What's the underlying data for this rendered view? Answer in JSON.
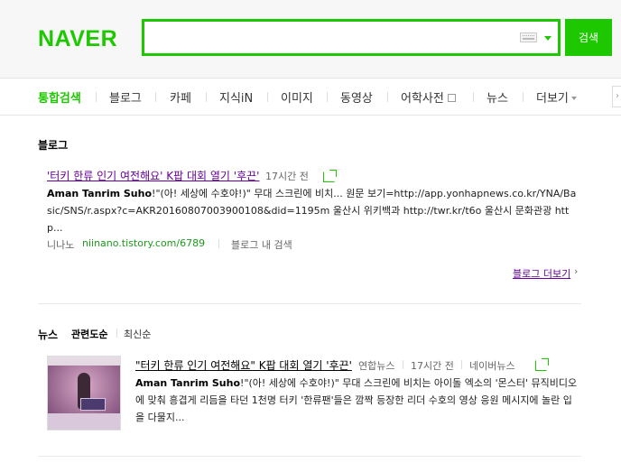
{
  "header": {
    "logo": "NAVER",
    "search_value": "",
    "search_button": "검색"
  },
  "tabs": [
    {
      "label": "통합검색",
      "active": true
    },
    {
      "label": "블로그"
    },
    {
      "label": "카페"
    },
    {
      "label": "지식iN"
    },
    {
      "label": "이미지"
    },
    {
      "label": "동영상"
    },
    {
      "label": "어학사전"
    },
    {
      "label": "뉴스"
    },
    {
      "label": "더보기"
    }
  ],
  "blog": {
    "section_title": "블로그",
    "title": "'터키 한류 인기 여전해요' K팝 대회 열기 '후끈'",
    "time": "17시간 전",
    "desc_bold": "Aman Tanrim Suho",
    "desc": "!\"(아! 세상에 수호야!)\" 무대 스크린에 비치... 원문 보기=http://app.yonhapnews.co.kr/YNA/Basic/SNS/r.aspx?c=AKR20160807003900108&did=1195m 울산시 위키백과 http://twr.kr/t6o 울산시 문화관광 http...",
    "author": "니나노",
    "url": "niinano.tistory.com/6789",
    "in_blog_search": "블로그 내 검색",
    "more": "블로그 더보기"
  },
  "news": {
    "section_title": "뉴스",
    "sort_relevance": "관련도순",
    "sort_latest": "최신순",
    "title": "\"터키 한류 인기 여전해요\" K팝 대회 열기 '후끈'",
    "publisher": "연합뉴스",
    "time": "17시간 전",
    "portal": "네이버뉴스",
    "desc_bold": "Aman Tanrim Suho",
    "desc": "!\"(아! 세상에 수호야!)\" 무대 스크린에 비치는 아이돌 엑소의 '몬스터' 뮤직비디오에 맞춰 흥겹게 리듬을 타던 1천명 터키 '한류팬'들은 깜짝 등장한 리더 수호의 영상 응원 메시지에 놀란 입을 다물지..."
  },
  "colors": {
    "brand_green": "#1ec800",
    "visited_link": "#660099",
    "url_green": "#1a9b1a"
  }
}
